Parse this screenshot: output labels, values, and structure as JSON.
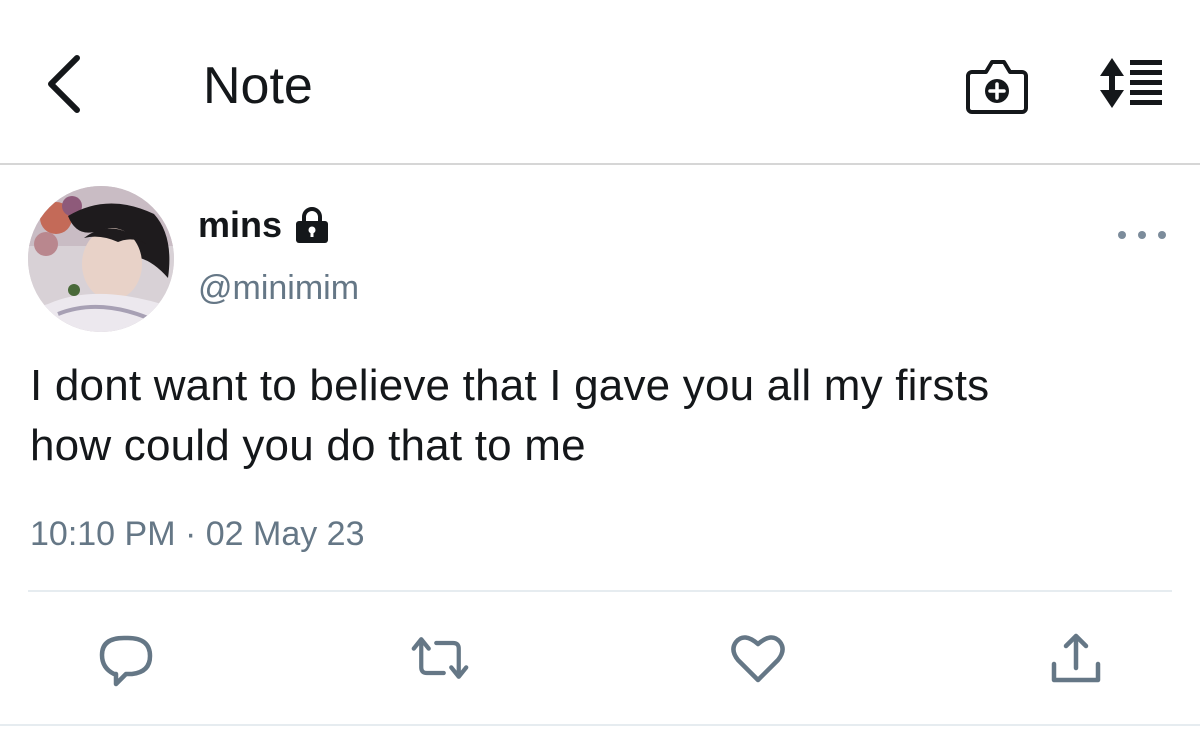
{
  "header": {
    "title": "Note",
    "back_icon": "chevron-left-icon",
    "camera_icon": "camera-plus-icon",
    "sort_icon": "sort-list-icon"
  },
  "tweet": {
    "display_name": "mins",
    "protected_icon": "lock-icon",
    "handle": "@minimim",
    "text_lines": [
      "I dont want to believe that I gave you all my firsts",
      "how could you do that to me"
    ],
    "timestamp": "10:10 PM · 02 May 23",
    "more_icon": "more-horizontal-icon"
  },
  "actions": {
    "reply_icon": "reply-icon",
    "retweet_icon": "retweet-icon",
    "like_icon": "heart-icon",
    "share_icon": "share-icon"
  },
  "colors": {
    "icon_gray": "#657786",
    "text_dark": "#14171a",
    "divider": "#e6ecf0"
  }
}
